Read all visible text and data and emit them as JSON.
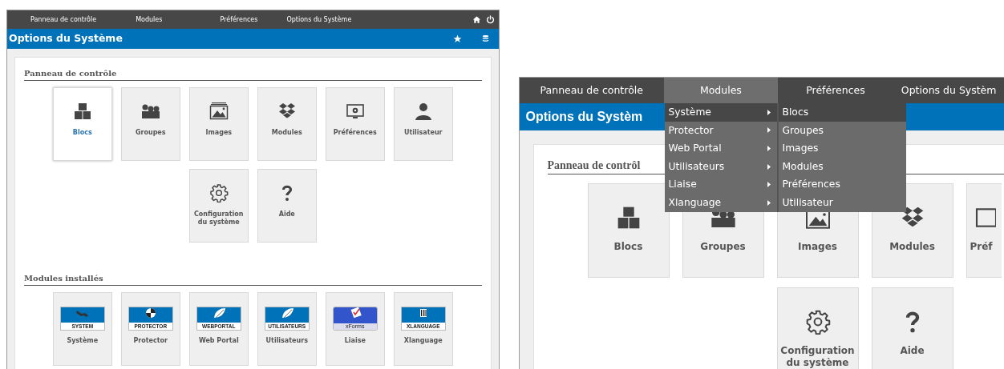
{
  "overview_screen": {
    "nav": [
      {
        "label": "Panneau de contrôle"
      },
      {
        "label": "Modules"
      },
      {
        "label": "Préférences"
      },
      {
        "label": "Options du Système"
      }
    ],
    "title": "Options du Système",
    "sections": [
      {
        "heading": "Panneau de contrôle",
        "tiles": [
          {
            "label": "Blocs",
            "selected": true
          },
          {
            "label": "Groupes",
            "selected": false
          },
          {
            "label": "Images",
            "selected": false
          },
          {
            "label": "Modules",
            "selected": false
          },
          {
            "label": "Préférences",
            "selected": false
          },
          {
            "label": "Utilisateur",
            "selected": false
          },
          {
            "label": "Configuration du système",
            "selected": false
          },
          {
            "label": "Aide",
            "selected": false
          }
        ]
      },
      {
        "heading": "Modules installés",
        "tiles": [
          {
            "label": "Système",
            "logo_text": "SYSTEM",
            "selected": false
          },
          {
            "label": "Protector",
            "logo_text": "PROTECTOR",
            "selected": false
          },
          {
            "label": "Web Portal",
            "logo_text": "WEBPORTAL",
            "selected": false
          },
          {
            "label": "Utilisateurs",
            "logo_text": "UTILISATEURS",
            "selected": false
          },
          {
            "label": "Liaise",
            "logo_text": "xForms",
            "selected": false
          },
          {
            "label": "Xlanguage",
            "logo_text": "XLANGUAGE",
            "selected": false
          }
        ]
      }
    ]
  },
  "menu_screen": {
    "nav": [
      {
        "label": "Panneau de contrôle",
        "selected": false
      },
      {
        "label": "Modules",
        "selected": true
      },
      {
        "label": "Préférences",
        "selected": false
      },
      {
        "label": "Options du Systèm",
        "selected": false
      }
    ],
    "menu": [
      {
        "label": "Système",
        "selected": true
      },
      {
        "label": "Protector",
        "selected": false
      },
      {
        "label": "Web Portal",
        "selected": false
      },
      {
        "label": "Utilisateurs",
        "selected": false
      },
      {
        "label": "Liaise",
        "selected": false
      },
      {
        "label": "Xlanguage",
        "selected": false
      }
    ],
    "submenu": [
      {
        "label": "Blocs",
        "selected": true
      },
      {
        "label": "Groupes",
        "selected": false
      },
      {
        "label": "Images",
        "selected": false
      },
      {
        "label": "Modules",
        "selected": false
      },
      {
        "label": "Préférences",
        "selected": false
      },
      {
        "label": "Utilisateur",
        "selected": false
      }
    ],
    "title": "Options du Systèm",
    "heading": "Panneau de contrôl",
    "tile_rows": [
      [
        {
          "label": "Blocs",
          "clipped": false
        },
        {
          "label": "Groupes",
          "clipped": false
        },
        {
          "label": "Images",
          "clipped": false
        },
        {
          "label": "Modules",
          "clipped": false
        },
        {
          "label": "Préf",
          "clipped": true
        }
      ],
      [
        {
          "label": "Configuration du système",
          "clipped": false
        },
        {
          "label": "Aide",
          "clipped": false
        }
      ]
    ]
  }
}
